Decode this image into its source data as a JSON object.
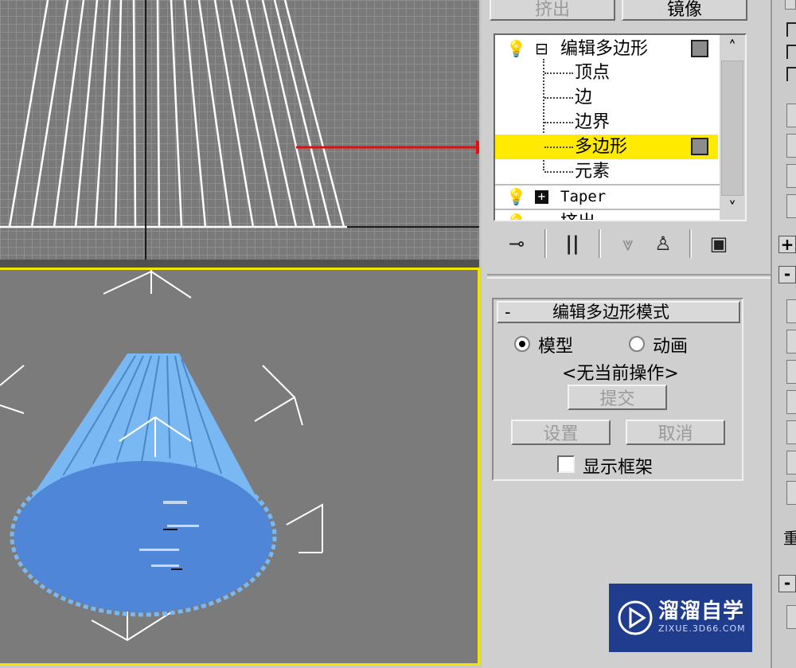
{
  "top_buttons": {
    "extrude_label": "挤出",
    "mirror_label": "镜像"
  },
  "modifier_stack": {
    "items": [
      {
        "label": "编辑多边形",
        "level": 0,
        "expand": "⊟"
      },
      {
        "label": "顶点",
        "level": 1
      },
      {
        "label": "边",
        "level": 1
      },
      {
        "label": "边界",
        "level": 1
      },
      {
        "label": "多边形",
        "level": 1,
        "selected": true
      },
      {
        "label": "元素",
        "level": 1
      },
      {
        "label": "Taper",
        "level": 0,
        "expand": "⊞"
      },
      {
        "label": "挤出",
        "level": 0
      }
    ],
    "scroll_up": "˄",
    "scroll_down": "˅"
  },
  "rollout": {
    "title": "编辑多边形模式",
    "collapse_symbol": "-",
    "radio_model": "模型",
    "radio_animate": "动画",
    "status": "<无当前操作>",
    "commit_label": "提交",
    "settings_label": "设置",
    "cancel_label": "取消",
    "show_cage_label": "显示框架"
  },
  "strip": {
    "plus": "+",
    "minus": "-",
    "weight_char": "重"
  },
  "watermark": {
    "brand": "溜溜自学",
    "url": "ZIXUE.3D66.COM"
  },
  "colors": {
    "selected_row": "#ffea00",
    "viewport_border": "#f2e600",
    "arrow": "#e01010",
    "object": "#6fb1f0"
  }
}
